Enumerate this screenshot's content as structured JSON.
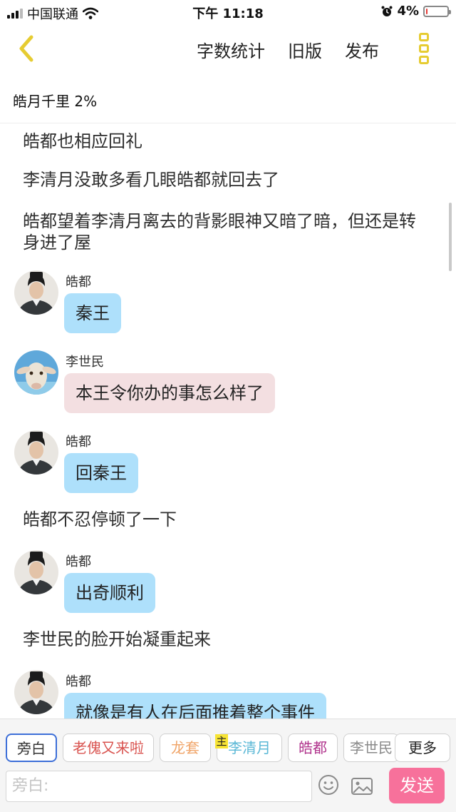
{
  "status_bar": {
    "carrier": "中国联通",
    "time": "下午 11:18",
    "battery": "4%",
    "battery_level": 0.04
  },
  "nav": {
    "actions": [
      "字数统计",
      "旧版",
      "发布"
    ]
  },
  "chapter": {
    "title": "皓月千里 2%"
  },
  "messages": [
    {
      "type": "narration",
      "text": "皓都也相应回礼"
    },
    {
      "type": "narration",
      "text": "李清月没敢多看几眼皓都就回去了"
    },
    {
      "type": "narration",
      "text": "皓都望着李清月离去的背影眼神又暗了暗，但还是转身进了屋"
    },
    {
      "type": "dialogue",
      "speaker": "皓都",
      "text": "秦王"
    },
    {
      "type": "dialogue",
      "speaker": "李世民",
      "text": "本王令你办的事怎么样了"
    },
    {
      "type": "dialogue",
      "speaker": "皓都",
      "text": "回秦王"
    },
    {
      "type": "narration",
      "text": "皓都不忍停顿了一下"
    },
    {
      "type": "dialogue",
      "speaker": "皓都",
      "text": "出奇顺利"
    },
    {
      "type": "narration",
      "text": "李世民的脸开始凝重起来"
    },
    {
      "type": "dialogue",
      "speaker": "皓都",
      "text": "就像是有人在后面推着整个事件"
    }
  ],
  "roles": [
    {
      "label": "旁白",
      "color": "#333333"
    },
    {
      "label": "老傀又来啦",
      "color": "#d9534f"
    },
    {
      "label": "龙套",
      "color": "#f0a468"
    },
    {
      "label": "李清月",
      "color": "#5bb8d6"
    },
    {
      "label": "皓都",
      "color": "#b0338c"
    },
    {
      "label": "李世民",
      "color": "#8a8a8a"
    }
  ],
  "host_badge": "主",
  "more_label": "更多",
  "input": {
    "placeholder": "旁白:"
  },
  "send_label": "发送",
  "colors": {
    "bubble_blue": "#aee0fb",
    "bubble_pink": "#f3dfe1",
    "send": "#f7719b",
    "accent_yellow": "#e6cc32"
  },
  "icons": [
    "back-chevron-icon",
    "more-menu-icon",
    "emoji-icon",
    "image-icon",
    "signal-icon",
    "wifi-icon",
    "alarm-icon",
    "battery-icon"
  ]
}
